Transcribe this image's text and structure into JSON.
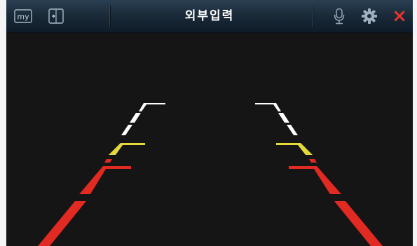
{
  "window": {
    "title": "외부입력"
  },
  "toolbar": {
    "left": [
      {
        "name": "my-menu-button",
        "icon": "my-icon",
        "label": "my"
      },
      {
        "name": "exit-input-button",
        "icon": "enter-exit-icon"
      }
    ],
    "right": [
      {
        "name": "voice-button",
        "icon": "microphone-icon"
      },
      {
        "name": "settings-button",
        "icon": "gear-icon"
      },
      {
        "name": "close-button",
        "icon": "close-icon",
        "label": "×"
      }
    ]
  },
  "guide_colors": {
    "near": "#e12a22",
    "mid": "#e4d93a",
    "far": "#ffffff",
    "background": "#151515",
    "close_icon": "#e5362c"
  }
}
